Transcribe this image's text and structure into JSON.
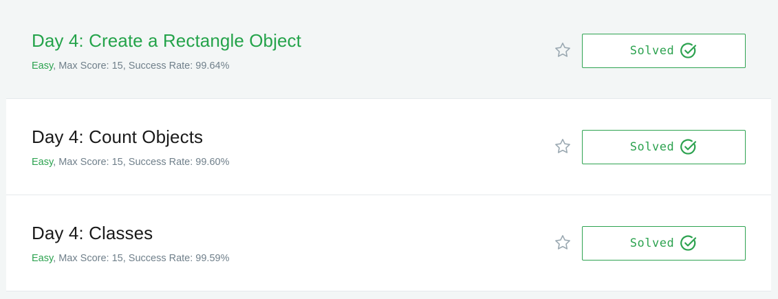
{
  "challenges": [
    {
      "title": "Day 4: Create a Rectangle Object",
      "difficulty": "Easy",
      "details": ", Max Score: 15, Success Rate: 99.64%",
      "status_label": "Solved",
      "hovered": true
    },
    {
      "title": "Day 4: Count Objects",
      "difficulty": "Easy",
      "details": ", Max Score: 15, Success Rate: 99.60%",
      "status_label": "Solved",
      "hovered": false
    },
    {
      "title": "Day 4: Classes",
      "difficulty": "Easy",
      "details": ", Max Score: 15, Success Rate: 99.59%",
      "status_label": "Solved",
      "hovered": false
    }
  ],
  "icons": {
    "star": "star-outline-icon",
    "check": "check-circle-icon"
  },
  "colors": {
    "accent_green": "#2ca24f",
    "title_hover_green": "#24a34a",
    "meta_gray": "#6f7f8a",
    "page_bg": "#f3f6f6",
    "card_bg": "#ffffff",
    "star_gray": "#9aa8b1"
  }
}
